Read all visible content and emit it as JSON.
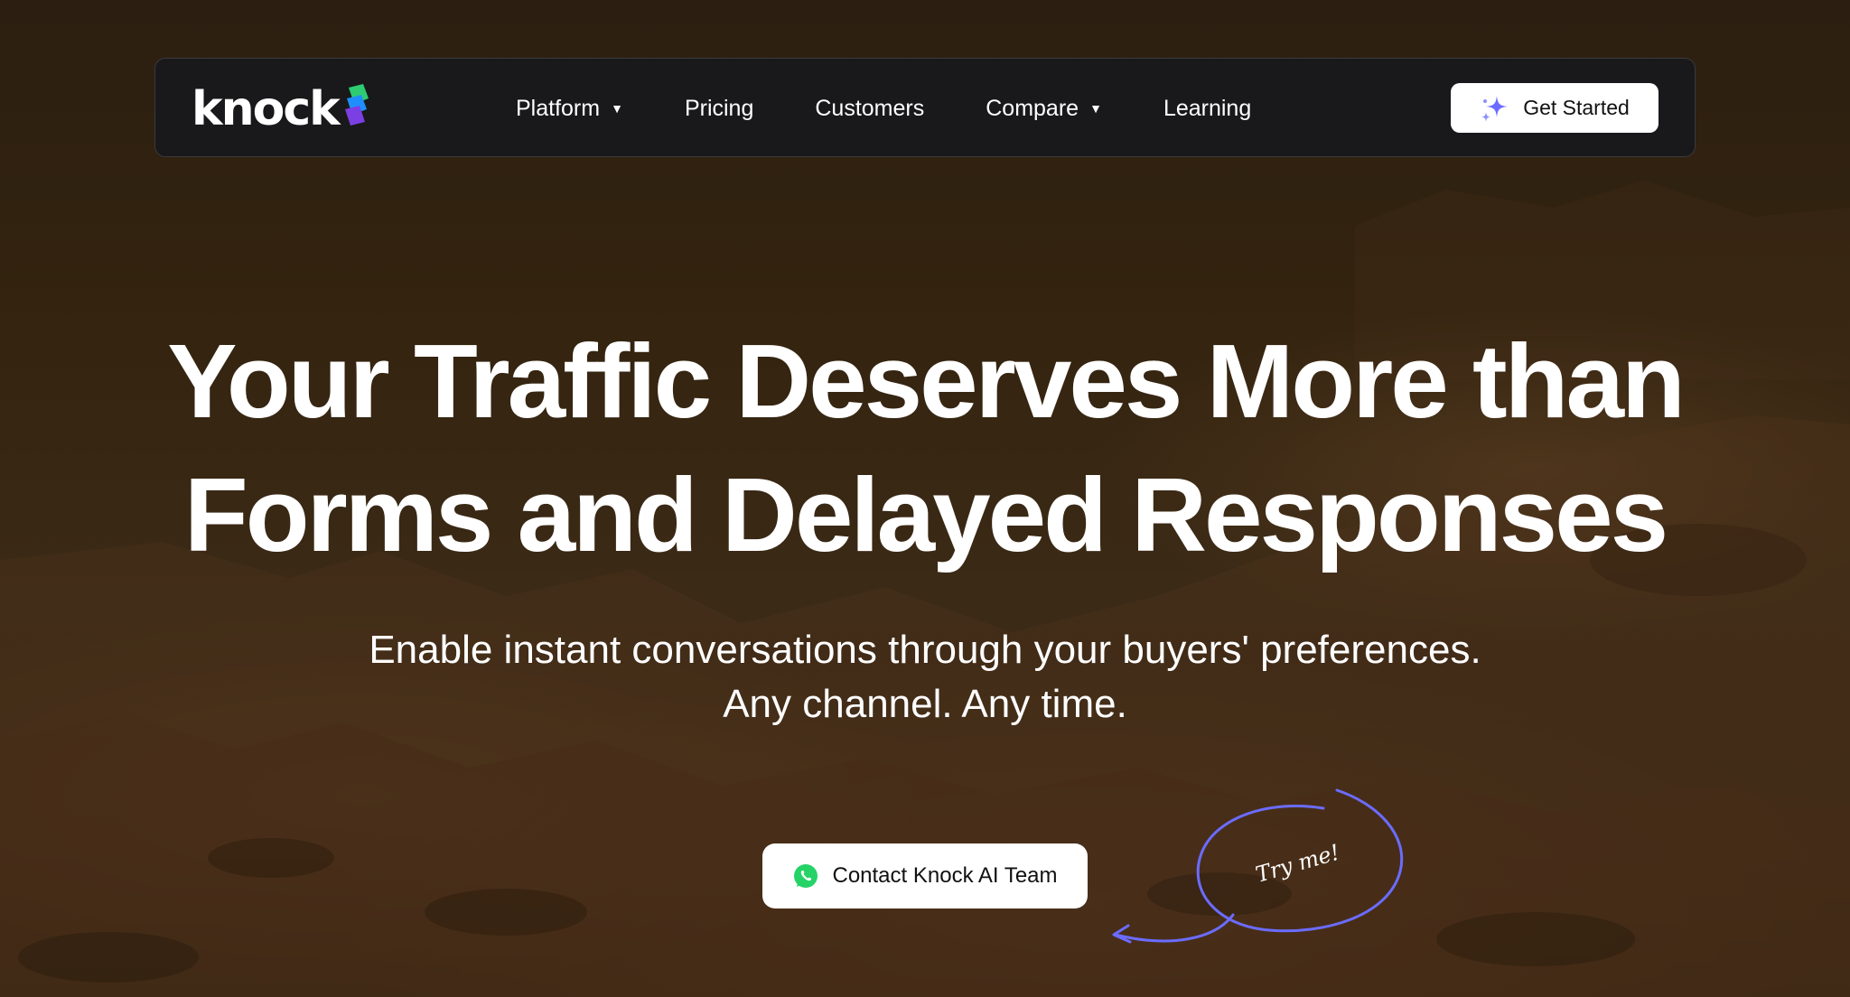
{
  "brand": {
    "logo_text": "knock"
  },
  "nav": {
    "items": [
      {
        "label": "Platform",
        "has_dropdown": true
      },
      {
        "label": "Pricing",
        "has_dropdown": false
      },
      {
        "label": "Customers",
        "has_dropdown": false
      },
      {
        "label": "Compare",
        "has_dropdown": true
      },
      {
        "label": "Learning",
        "has_dropdown": false
      }
    ],
    "cta_label": "Get Started",
    "cta_icon": "sparkle-icon"
  },
  "hero": {
    "headline_line1": "Your Traffic Deserves More than",
    "headline_line2": "Forms and Delayed Responses",
    "subtext_line1": "Enable instant conversations through your buyers' preferences.",
    "subtext_line2": "Any channel. Any time.",
    "cta_label": "Contact Knock AI Team",
    "cta_icon": "whatsapp-icon",
    "annotation": "Try me!"
  },
  "colors": {
    "accent": "#6b6cff",
    "navbar_bg": "#19191b",
    "whatsapp": "#25d366"
  }
}
